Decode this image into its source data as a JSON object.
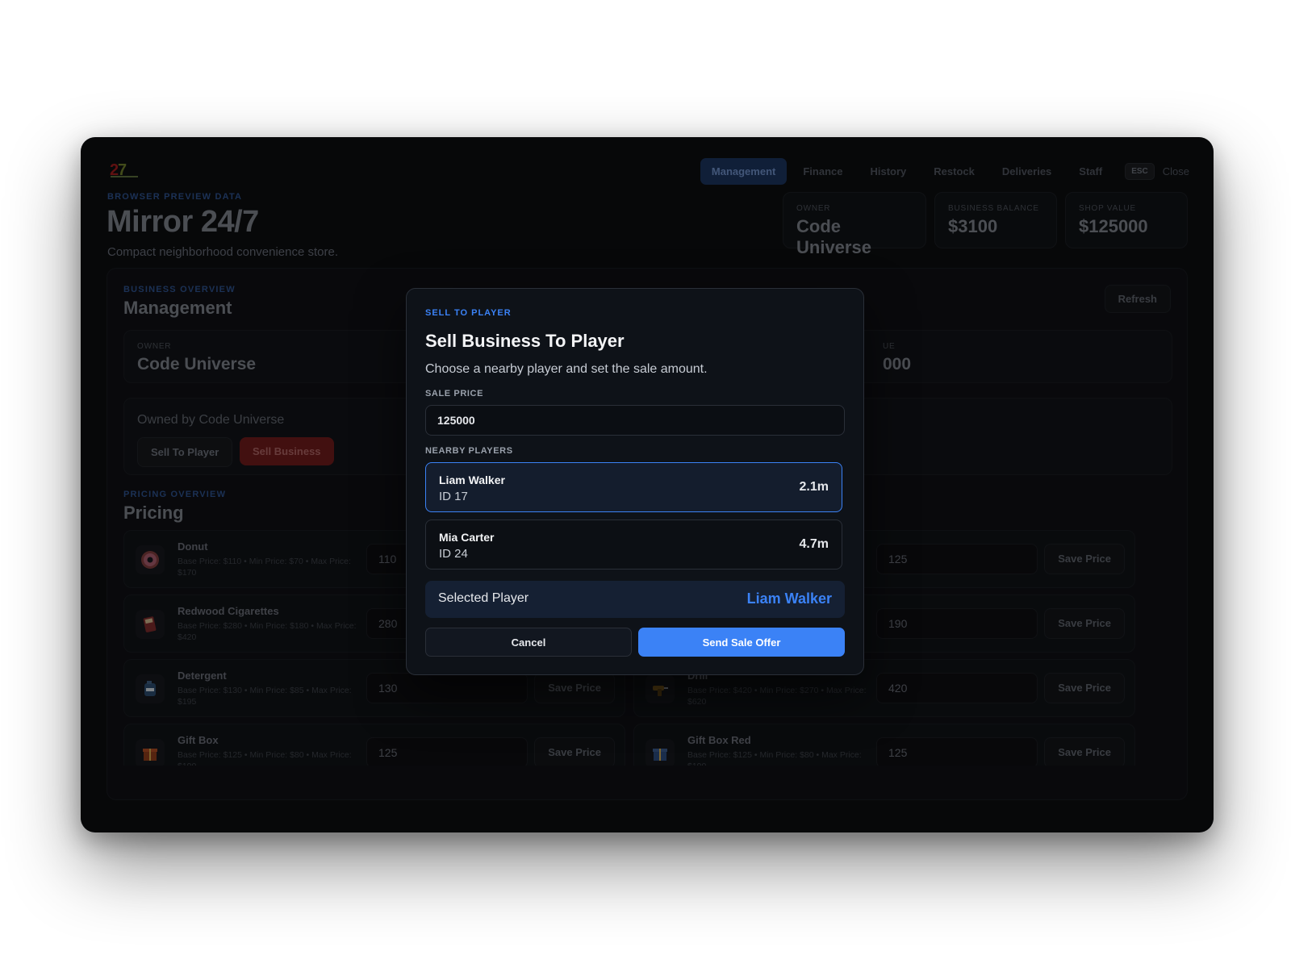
{
  "app": {
    "eyebrow": "BROWSER PREVIEW DATA",
    "title": "Mirror 24/7",
    "subtitle": "Compact neighborhood convenience store."
  },
  "nav": {
    "tabs": [
      "Management",
      "Finance",
      "History",
      "Restock",
      "Deliveries",
      "Staff"
    ],
    "active": "Management",
    "esc_key": "ESC",
    "close_label": "Close"
  },
  "stats": [
    {
      "label": "OWNER",
      "value": "Code Universe"
    },
    {
      "label": "BUSINESS BALANCE",
      "value": "$3100"
    },
    {
      "label": "SHOP VALUE",
      "value": "$125000"
    }
  ],
  "management": {
    "eyebrow": "BUSINESS OVERVIEW",
    "title": "Management",
    "refresh_label": "Refresh",
    "owner_label": "OWNER",
    "owner_value": "Code Universe",
    "partial_label": "UE",
    "partial_value": "000",
    "owned_text": "Owned by Code Universe",
    "sell_to_player_label": "Sell To Player",
    "sell_business_label": "Sell Business"
  },
  "pricing": {
    "eyebrow": "PRICING OVERVIEW",
    "title": "Pricing",
    "save_label": "Save Price",
    "items": [
      {
        "name": "Donut",
        "meta": "Base Price: $110 • Min Price: $70 • Max Price: $170",
        "value": "110",
        "icon": "donut-icon"
      },
      {
        "name": "",
        "meta": "",
        "value": "125",
        "icon": ""
      },
      {
        "name": "Redwood Cigarettes",
        "meta": "Base Price: $280 • Min Price: $180 • Max Price: $420",
        "value": "280",
        "icon": "cigarettes-icon"
      },
      {
        "name": "",
        "meta": "",
        "value": "190",
        "icon": ""
      },
      {
        "name": "Detergent",
        "meta": "Base Price: $130 • Min Price: $85 • Max Price: $195",
        "value": "130",
        "icon": "detergent-icon"
      },
      {
        "name": "Drill",
        "meta": "Base Price: $420 • Min Price: $270 • Max Price: $620",
        "value": "420",
        "icon": "drill-icon"
      },
      {
        "name": "Gift Box",
        "meta": "Base Price: $125 • Min Price: $80 • Max Price: $190",
        "value": "125",
        "icon": "gift-box-icon"
      },
      {
        "name": "Gift Box Red",
        "meta": "Base Price: $125 • Min Price: $80 • Max Price: $190",
        "value": "125",
        "icon": "gift-box-blue-icon"
      }
    ]
  },
  "modal": {
    "eyebrow": "SELL TO PLAYER",
    "title": "Sell Business To Player",
    "subtitle": "Choose a nearby player and set the sale amount.",
    "sale_price_label": "SALE PRICE",
    "sale_price_value": "125000",
    "nearby_label": "NEARBY PLAYERS",
    "players": [
      {
        "name": "Liam Walker",
        "id": "ID 17",
        "distance": "2.1m",
        "selected": true
      },
      {
        "name": "Mia Carter",
        "id": "ID 24",
        "distance": "4.7m",
        "selected": false
      }
    ],
    "selected_label": "Selected Player",
    "selected_value": "Liam Walker",
    "cancel_label": "Cancel",
    "send_label": "Send Sale Offer"
  },
  "colors": {
    "accent": "#3b82f6",
    "danger": "#6b1b1b",
    "background": "#0c0d10"
  }
}
